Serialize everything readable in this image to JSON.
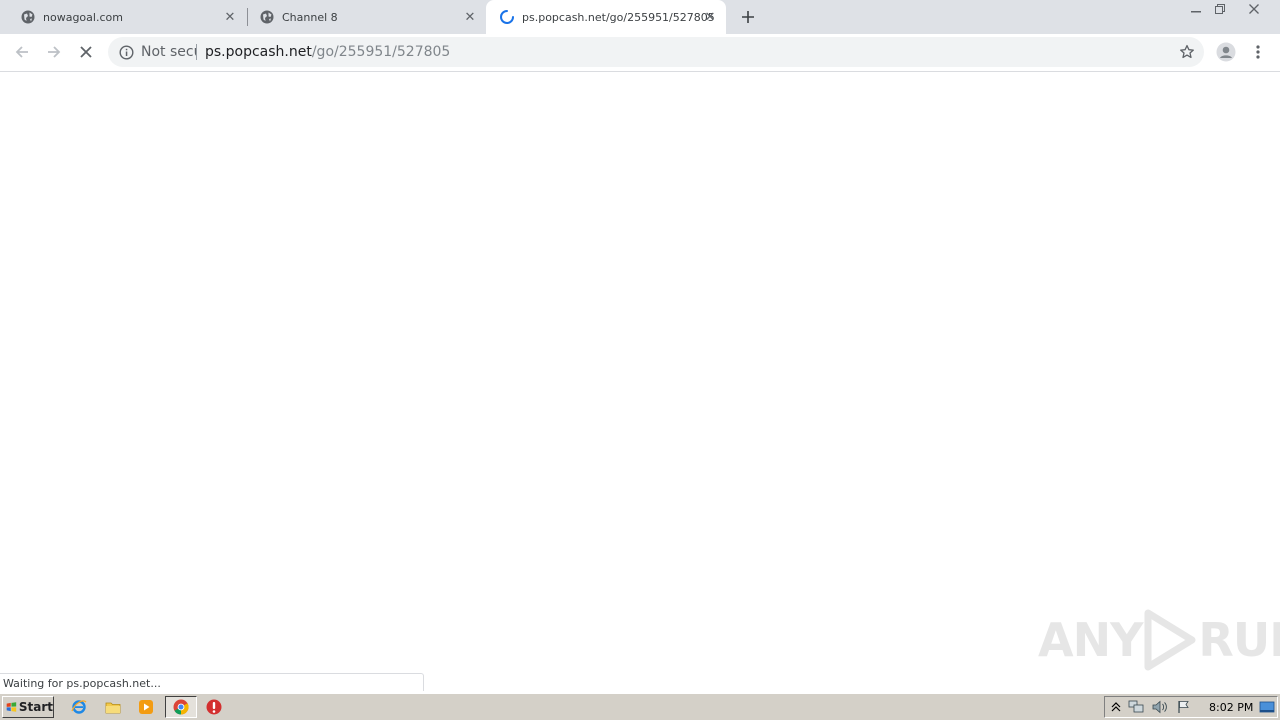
{
  "browser": {
    "tabs": [
      {
        "title": "nowagoal.com",
        "icon": "globe-icon",
        "active": false
      },
      {
        "title": "Channel 8",
        "icon": "globe-icon",
        "active": false
      },
      {
        "title": "ps.popcash.net/go/255951/527805",
        "icon": "loading-spinner-icon",
        "active": true
      }
    ],
    "new_tab_icon": "plus-icon",
    "security_label": "Not secure",
    "url_host": "ps.popcash.net",
    "url_path": "/go/255951/527805",
    "status_text": "Waiting for ps.popcash.net..."
  },
  "watermark": {
    "text_left": "ANY",
    "text_right": "RUN"
  },
  "taskbar": {
    "start_label": "Start",
    "clock": "8:02 PM"
  },
  "colors": {
    "tabstrip_bg": "#dee1e6",
    "omnibox_bg": "#f1f3f4",
    "spinner": "#1a73e8",
    "taskbar_bg": "#d4d0c8"
  }
}
